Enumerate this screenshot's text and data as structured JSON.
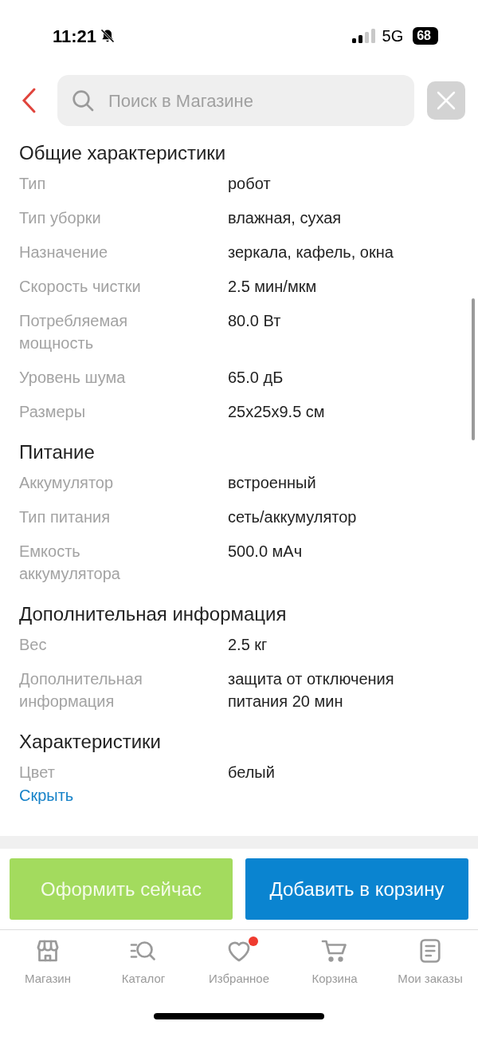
{
  "status_bar": {
    "time": "11:21",
    "network": "5G",
    "battery": "68"
  },
  "search": {
    "placeholder": "Поиск в Магазине"
  },
  "sections": [
    {
      "title": "Общие характеристики",
      "rows": [
        {
          "label": "Тип",
          "value": "робот"
        },
        {
          "label": "Тип уборки",
          "value": "влажная, сухая"
        },
        {
          "label": "Назначение",
          "value": "зеркала, кафель, окна"
        },
        {
          "label": "Скорость чистки",
          "value": "2.5 мин/мкм"
        },
        {
          "label": "Потребляемая мощность",
          "value": "80.0 Вт"
        },
        {
          "label": "Уровень шума",
          "value": "65.0 дБ"
        },
        {
          "label": "Размеры",
          "value": "25x25x9.5 см"
        }
      ]
    },
    {
      "title": "Питание",
      "rows": [
        {
          "label": "Аккумулятор",
          "value": "встроенный"
        },
        {
          "label": "Тип питания",
          "value": "сеть/аккумулятор"
        },
        {
          "label": "Емкость аккумулятора",
          "value": "500.0 мАч"
        }
      ]
    },
    {
      "title": "Дополнительная информация",
      "rows": [
        {
          "label": "Вес",
          "value": "2.5 кг"
        },
        {
          "label": "Дополнительная информация",
          "value": "защита от отключения питания 20 мин"
        }
      ]
    },
    {
      "title": "Характеристики",
      "rows": [
        {
          "label": "Цвет",
          "value": "белый"
        }
      ]
    }
  ],
  "hide_link": "Скрыть",
  "actions": [
    {
      "label": "Оформить сейчас",
      "kind": "secondary"
    },
    {
      "label": "Добавить в корзину",
      "kind": "primary"
    }
  ],
  "nav": [
    {
      "label": "Магазин",
      "kind": "store",
      "badge": false
    },
    {
      "label": "Каталог",
      "kind": "catalog",
      "badge": false
    },
    {
      "label": "Избранное",
      "kind": "heart",
      "badge": true
    },
    {
      "label": "Корзина",
      "kind": "cart",
      "badge": false
    },
    {
      "label": "Мои заказы",
      "kind": "orders",
      "badge": false
    }
  ]
}
